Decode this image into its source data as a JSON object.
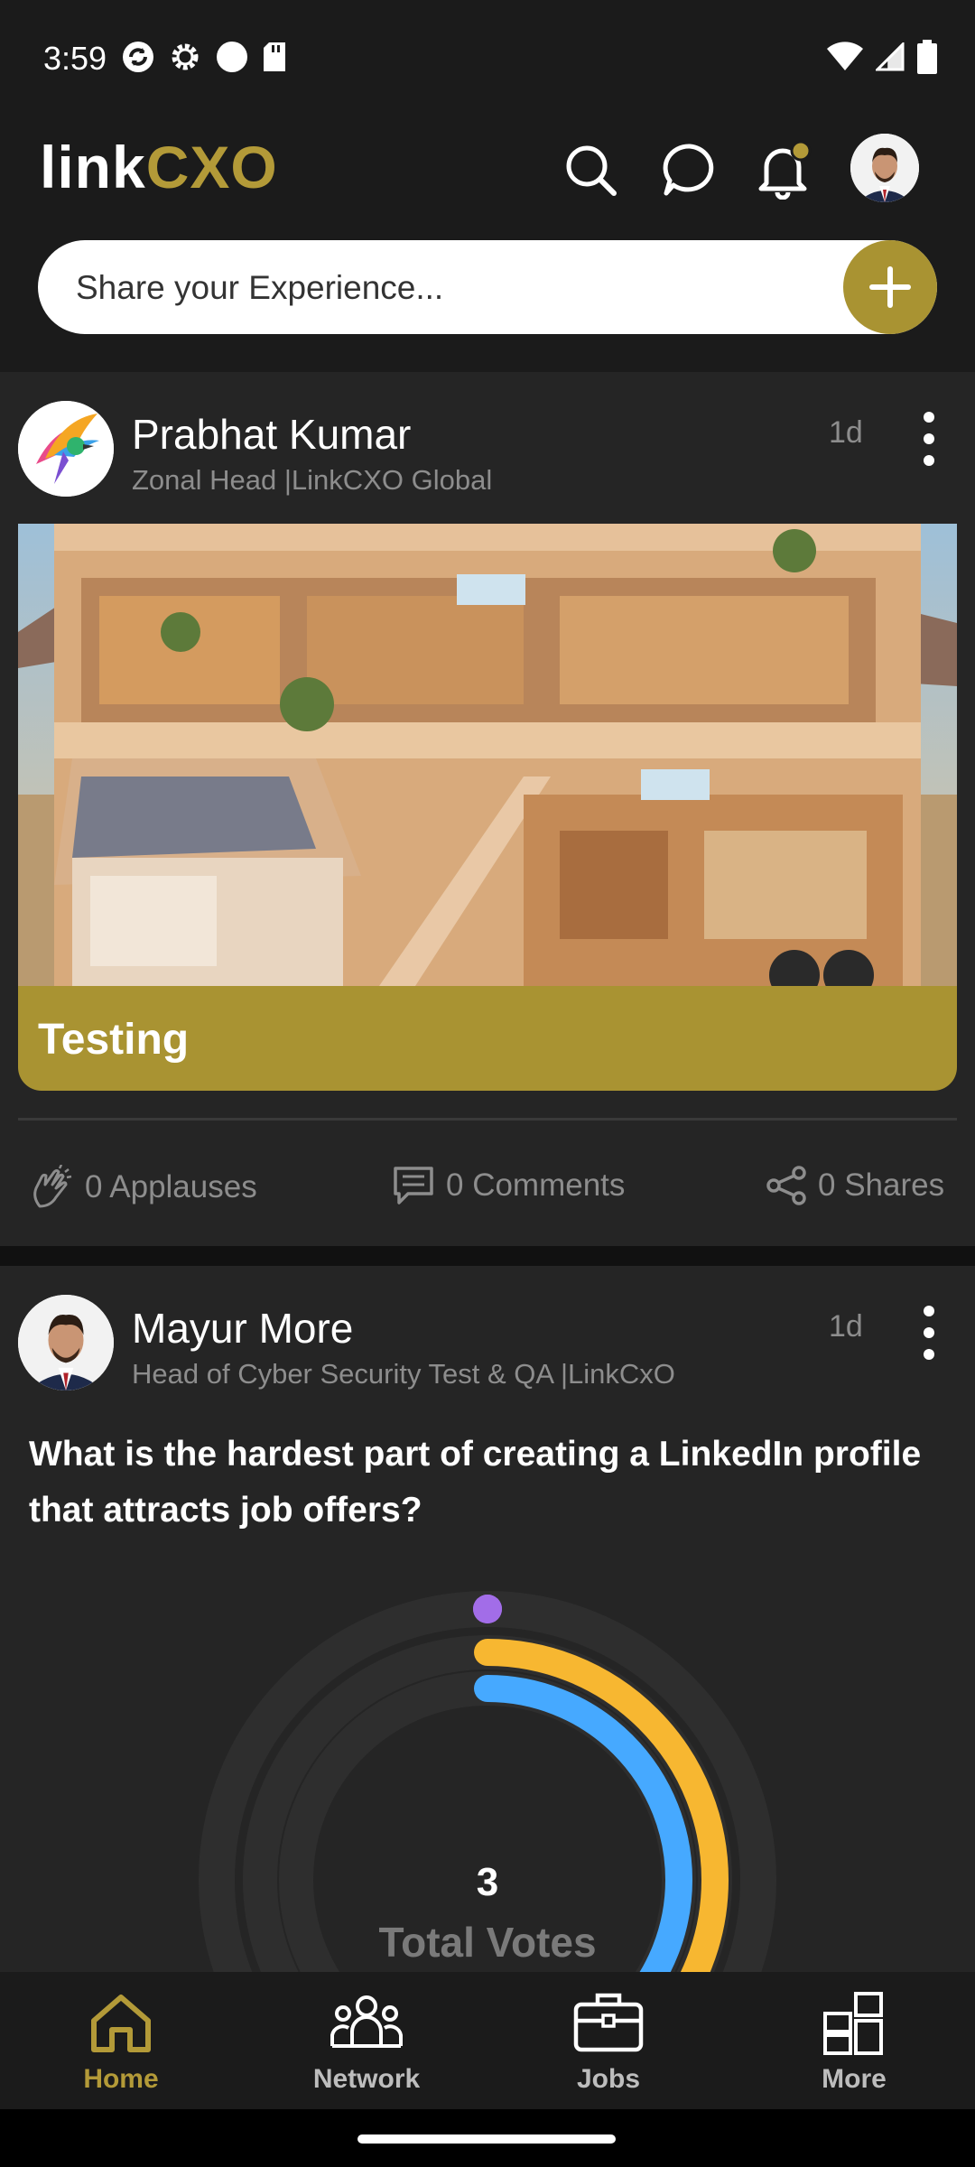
{
  "status_bar": {
    "time": "3:59"
  },
  "header": {
    "logo_link": "link",
    "logo_cxo": "CXO",
    "share_placeholder": "Share your Experience..."
  },
  "posts": [
    {
      "author": "Prabhat Kumar",
      "role": "Zonal Head |LinkCXO Global",
      "time": "1d",
      "caption": "Testing",
      "applauses": "0 Applauses",
      "comments": "0 Comments",
      "shares": "0 Shares"
    },
    {
      "author": "Mayur More",
      "role": "Head of Cyber Security Test & QA |LinkCxO",
      "time": "1d",
      "question": "What is the hardest part of creating a LinkedIn profile that attracts job offers?",
      "total_votes_number": "3",
      "total_votes_label": "Total Votes"
    }
  ],
  "chart_data": {
    "type": "radial-bar",
    "total": 3,
    "series": [
      {
        "value": 0,
        "color": "#a26de8"
      },
      {
        "value": 1.5,
        "color": "#f7b731"
      },
      {
        "value": 1.5,
        "color": "#46a9ff"
      }
    ]
  },
  "bottom_nav": {
    "home": "Home",
    "network": "Network",
    "jobs": "Jobs",
    "more": "More"
  },
  "colors": {
    "accent": "#b39a38",
    "background": "#1b1b1b",
    "card": "#252525"
  }
}
